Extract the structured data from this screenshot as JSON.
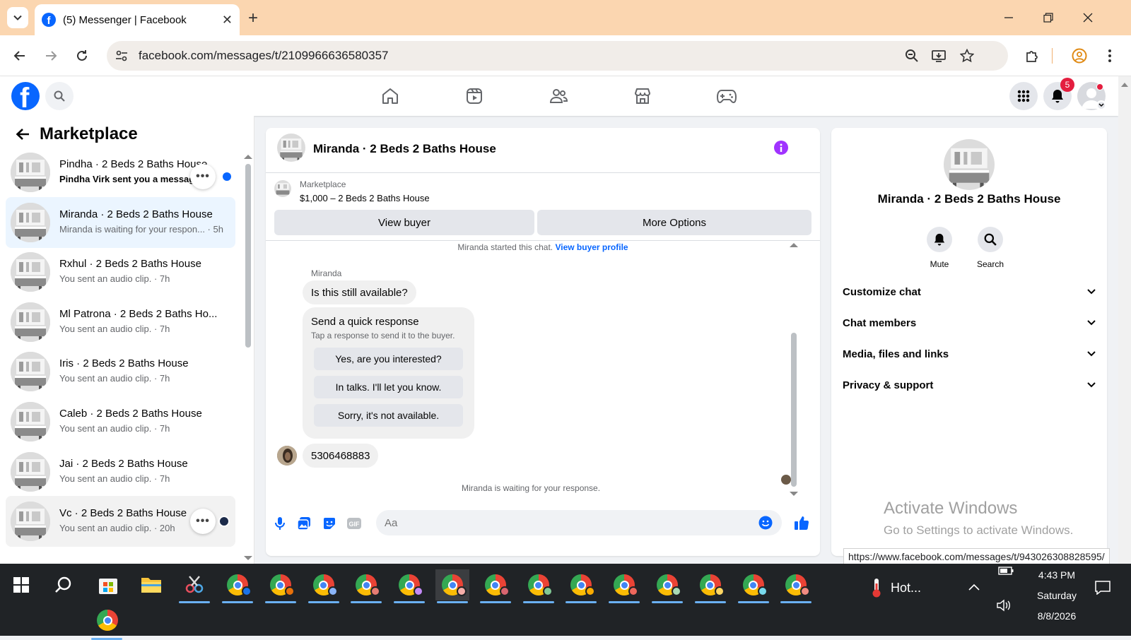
{
  "browser": {
    "tab_title": "(5) Messenger | Facebook",
    "url": "facebook.com/messages/t/2109966636580357",
    "status_url": "https://www.facebook.com/messages/t/943026308828595/"
  },
  "fb_header": {
    "notification_count": "5"
  },
  "left_panel": {
    "title": "Marketplace",
    "conversations": [
      {
        "name": "Pindha · 2 Beds 2 Baths House",
        "preview": "Pindha Virk sent you a message.",
        "unread": true
      },
      {
        "name": "Miranda · 2 Beds 2 Baths House",
        "preview": "Miranda is waiting for your respon... · 5h",
        "active": true
      },
      {
        "name": "Rxhul · 2 Beds 2 Baths House",
        "preview": "You sent an audio clip. · 7h"
      },
      {
        "name": "Ml Patrona · 2 Beds 2 Baths Ho...",
        "preview": "You sent an audio clip. · 7h"
      },
      {
        "name": "Iris · 2 Beds 2 Baths House",
        "preview": "You sent an audio clip. · 7h"
      },
      {
        "name": "Caleb · 2 Beds 2 Baths House",
        "preview": "You sent an audio clip. · 7h"
      },
      {
        "name": "Jai · 2 Beds 2 Baths House",
        "preview": "You sent an audio clip. · 7h"
      },
      {
        "name": "Vc · 2 Beds 2 Baths House",
        "preview": "You sent an audio clip. · 20h"
      }
    ]
  },
  "chat": {
    "title": "Miranda · 2 Beds 2 Baths House",
    "listing_source": "Marketplace",
    "listing_title": "$1,000 – 2 Beds 2 Baths House",
    "view_buyer_label": "View buyer",
    "more_options_label": "More Options",
    "started_text": "Miranda started this chat.",
    "view_buyer_profile_link": "View buyer profile",
    "sender_name": "Miranda",
    "first_message": "Is this still available?",
    "quick_response_title": "Send a quick response",
    "quick_response_subtitle": "Tap a response to send it to the buyer.",
    "quick_responses": [
      "Yes, are you interested?",
      "In talks. I'll let you know.",
      "Sorry, it's not available."
    ],
    "phone_message": "5306468883",
    "waiting_text": "Miranda is waiting for your response.",
    "composer_placeholder": "Aa"
  },
  "details": {
    "name": "Miranda · 2 Beds 2 Baths House",
    "mute_label": "Mute",
    "search_label": "Search",
    "sections": [
      "Customize chat",
      "Chat members",
      "Media, files and links",
      "Privacy & support"
    ]
  },
  "watermark": {
    "line1": "Activate Windows",
    "line2": "Go to Settings to activate Windows."
  },
  "taskbar": {
    "weather": "Hot...",
    "time": "4:43 PM",
    "day": "Saturday",
    "date": "8/8/2026"
  },
  "colors": {
    "accent": "#0866ff",
    "info_purple": "#a033ff",
    "tab_strip": "#fbd6b0"
  }
}
